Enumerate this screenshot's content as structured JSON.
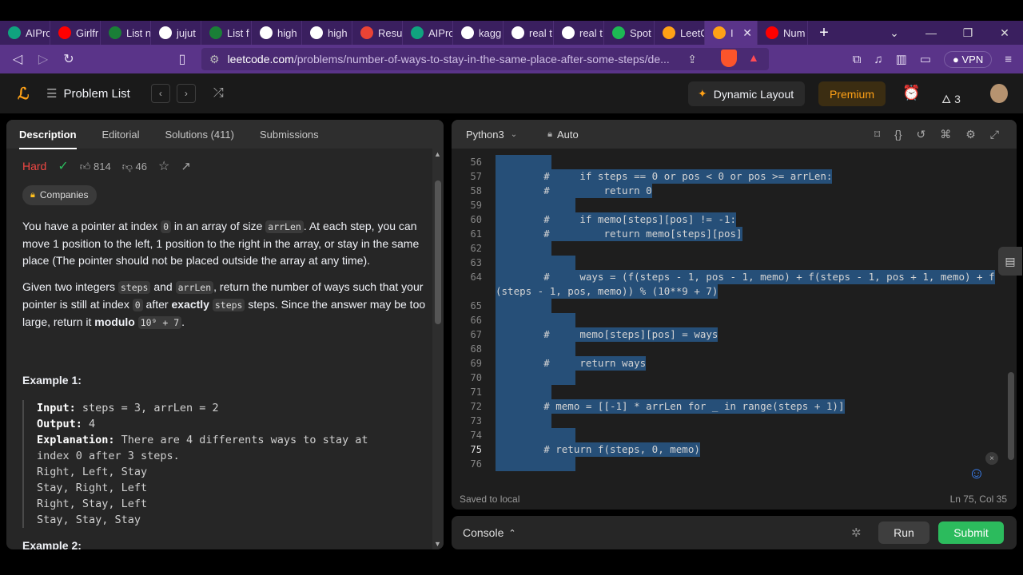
{
  "browser": {
    "tabs": [
      {
        "label": "AIPro",
        "icon": "openai-icon",
        "color": "#10a37f"
      },
      {
        "label": "Girlfr",
        "icon": "youtube-icon",
        "color": "#ff0000"
      },
      {
        "label": "List n",
        "icon": "tuf-icon",
        "color": "#1a7f37"
      },
      {
        "label": "jujut",
        "icon": "google-icon",
        "color": "#ffffff"
      },
      {
        "label": "List f",
        "icon": "tuf-icon",
        "color": "#1a7f37"
      },
      {
        "label": "high",
        "icon": "google-icon",
        "color": "#ffffff"
      },
      {
        "label": "high",
        "icon": "google-icon",
        "color": "#ffffff"
      },
      {
        "label": "Resul",
        "icon": "gmail-icon",
        "color": "#ea4335"
      },
      {
        "label": "AIPro",
        "icon": "openai-icon",
        "color": "#10a37f"
      },
      {
        "label": "kagg",
        "icon": "google-icon",
        "color": "#ffffff"
      },
      {
        "label": "real t",
        "icon": "google-icon",
        "color": "#ffffff"
      },
      {
        "label": "real t",
        "icon": "google-icon",
        "color": "#ffffff"
      },
      {
        "label": "Spot",
        "icon": "spotify-icon",
        "color": "#1db954"
      },
      {
        "label": "LeetC",
        "icon": "leetcode-icon",
        "color": "#ffa116"
      },
      {
        "label": "I",
        "icon": "leetcode-icon",
        "color": "#ffa116",
        "active": true
      },
      {
        "label": "Num",
        "icon": "youtube-icon",
        "color": "#ff0000"
      }
    ],
    "new_tab": "+",
    "url_host": "leetcode.com",
    "url_path": "/problems/number-of-ways-to-stay-in-the-same-place-after-some-steps/de...",
    "vpn_label": "VPN",
    "brave_badge": "4"
  },
  "nav": {
    "problem_list": "Problem List",
    "dynamic_layout": "Dynamic Layout",
    "premium": "Premium",
    "streak": "3"
  },
  "left": {
    "tabs": [
      "Description",
      "Editorial",
      "Solutions (411)",
      "Submissions"
    ],
    "difficulty": "Hard",
    "likes": "814",
    "dislikes": "46",
    "companies": "Companies",
    "p1_a": "You have a pointer at index ",
    "p1_code1": "0",
    "p1_b": " in an array of size ",
    "p1_code2": "arrLen",
    "p1_c": ". At each step, you can move 1 position to the left, 1 position to the right in the array, or stay in the same place (The pointer should not be placed outside the array at any time).",
    "p2_a": "Given two integers ",
    "p2_code1": "steps",
    "p2_b": " and ",
    "p2_code2": "arrLen",
    "p2_c": ", return the number of ways such that your pointer is still at index ",
    "p2_code3": "0",
    "p2_d": " after ",
    "p2_bold": "exactly",
    "p2_code4": "steps",
    "p2_e": " steps. Since the answer may be too large, return it ",
    "p2_bold2": "modulo",
    "p2_code5": "10⁹ + 7",
    "p2_f": ".",
    "example1_title": "Example 1:",
    "ex_input_label": "Input:",
    "ex_input": " steps = 3, arrLen = 2",
    "ex_output_label": "Output:",
    "ex_output": " 4",
    "ex_expl_label": "Explanation:",
    "ex_expl": " There are 4 differents ways to stay at",
    "ex_expl2": "index 0 after 3 steps.",
    "ex_lines": [
      "Right, Left, Stay",
      "Stay, Right, Left",
      "Right, Stay, Left",
      "Stay, Stay, Stay"
    ],
    "example2_title": "Example 2:"
  },
  "editor": {
    "language": "Python3",
    "mode": "Auto",
    "saved": "Saved to local",
    "cursor_pos": "Ln 75, Col 35",
    "lines": [
      {
        "n": "56",
        "t": ""
      },
      {
        "n": "57",
        "t": "        #     if steps == 0 or pos < 0 or pos >= arrLen:"
      },
      {
        "n": "58",
        "t": "        #         return 0"
      },
      {
        "n": "59",
        "t": ""
      },
      {
        "n": "60",
        "t": "        #     if memo[steps][pos] != -1:"
      },
      {
        "n": "61",
        "t": "        #         return memo[steps][pos]"
      },
      {
        "n": "62",
        "t": ""
      },
      {
        "n": "63",
        "t": ""
      },
      {
        "n": "64",
        "t": "        #     ways = (f(steps - 1, pos - 1, memo) + f(steps - 1, pos + 1, memo) + f"
      },
      {
        "n": "",
        "t": "(steps - 1, pos, memo)) % (10**9 + 7)"
      },
      {
        "n": "65",
        "t": ""
      },
      {
        "n": "66",
        "t": ""
      },
      {
        "n": "67",
        "t": "        #     memo[steps][pos] = ways"
      },
      {
        "n": "68",
        "t": ""
      },
      {
        "n": "69",
        "t": "        #     return ways"
      },
      {
        "n": "70",
        "t": ""
      },
      {
        "n": "71",
        "t": ""
      },
      {
        "n": "72",
        "t": "        # memo = [[-1] * arrLen for _ in range(steps + 1)]"
      },
      {
        "n": "73",
        "t": ""
      },
      {
        "n": "74",
        "t": ""
      },
      {
        "n": "75",
        "t": "        # return f(steps, 0, memo)"
      },
      {
        "n": "76",
        "t": ""
      }
    ]
  },
  "console": {
    "label": "Console",
    "run": "Run",
    "submit": "Submit"
  }
}
